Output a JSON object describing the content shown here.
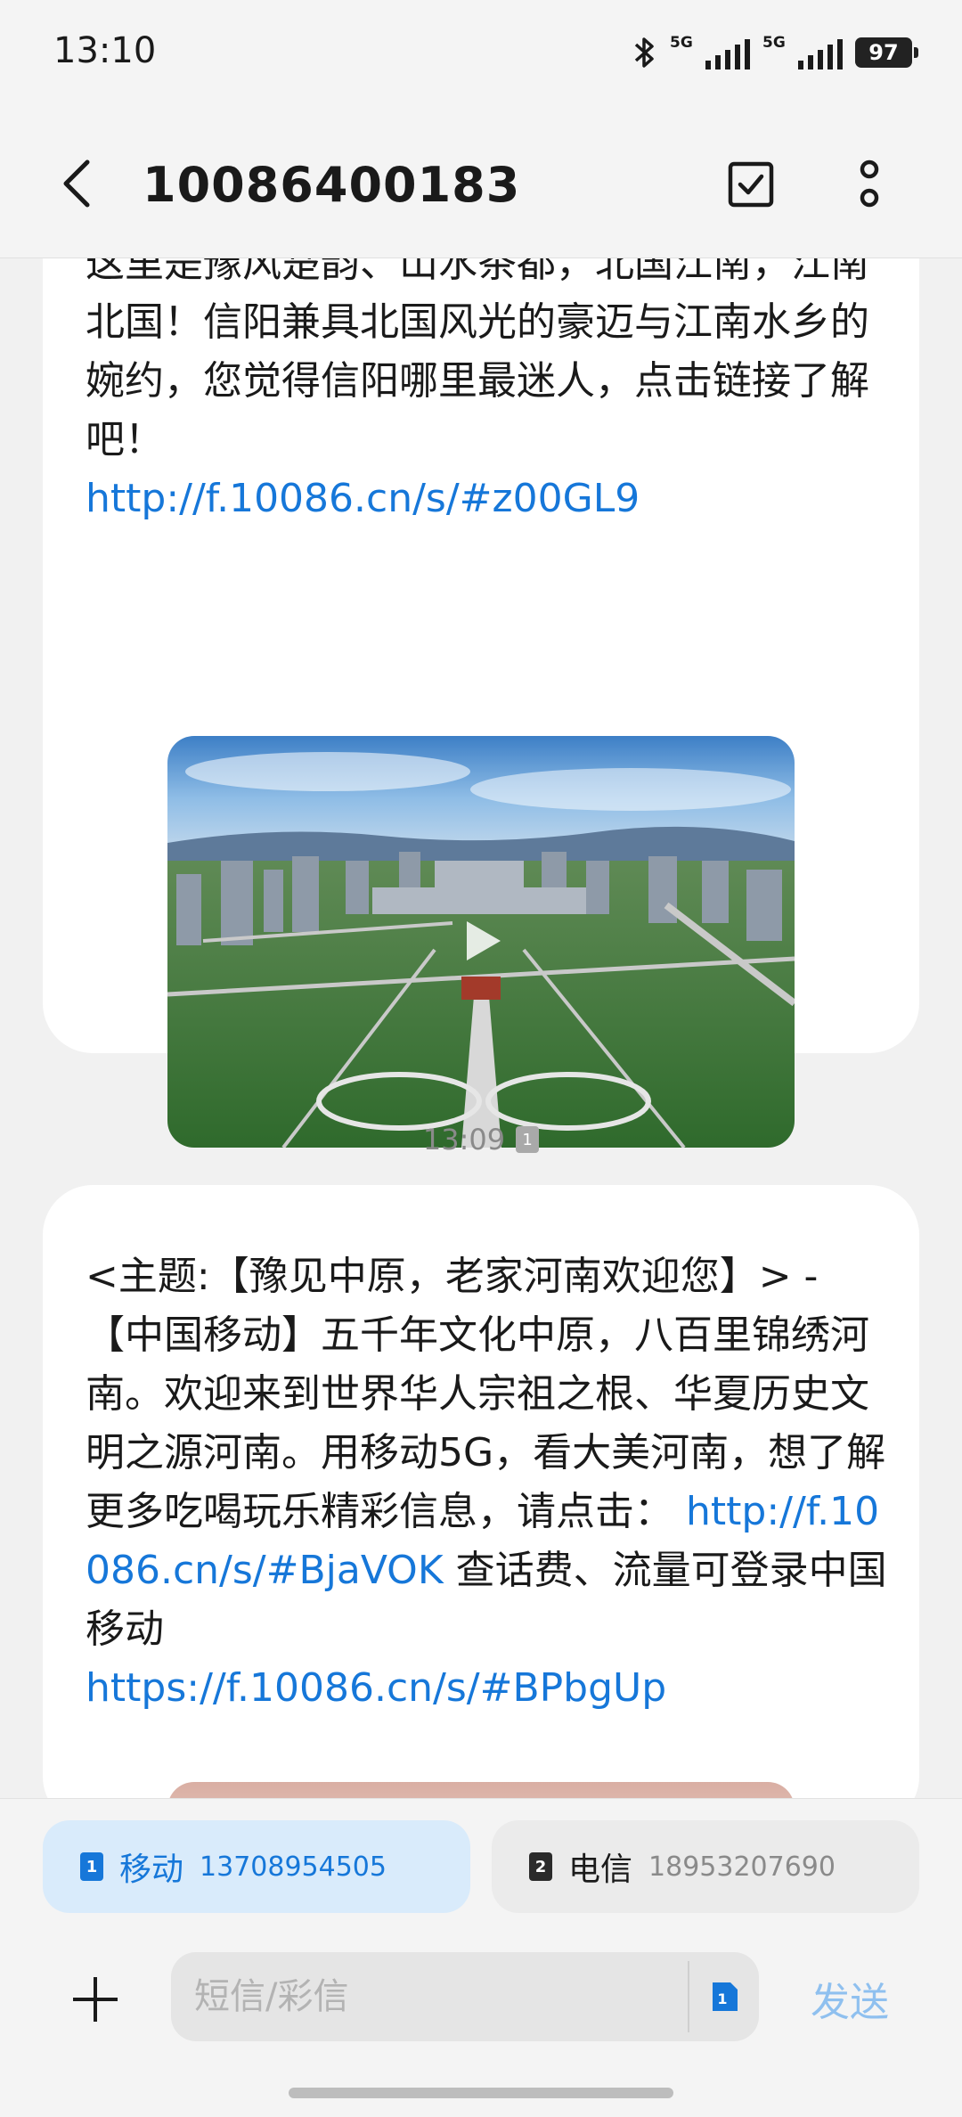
{
  "status_bar": {
    "time": "13:10",
    "network_1": "5G",
    "network_2": "5G",
    "battery": "97"
  },
  "header": {
    "title": "10086400183"
  },
  "messages": [
    {
      "text": "这里是豫风楚韵、山水茶都，北国江南，江南北国！信阳兼具北国风光的豪迈与江南水乡的婉约，您觉得信阳哪里最迷人，点击链接了解吧！",
      "link": "http://f.10086.cn/s/#z00GL9"
    },
    {
      "time": "13:09",
      "sim_badge": "1",
      "text_1": "<主题:【豫见中原，老家河南欢迎您】> -【中国移动】五千年文化中原，八百里锦绣河南。欢迎来到世界华人宗祖之根、华夏历史文明之源河南。用移动5G，看大美河南，想了解更多吃喝玩乐精彩信息，请点击：",
      "link_1": "http://f.10086.cn/s/#BjaVOK",
      "text_2": "查话费、流量可登录中国移动",
      "link_2": "https://f.10086.cn/s/#BPbgUp"
    }
  ],
  "sim_cards": [
    {
      "slot": "1",
      "name": "移动",
      "number": "13708954505",
      "selected": true
    },
    {
      "slot": "2",
      "name": "电信",
      "number": "18953207690",
      "selected": false
    }
  ],
  "compose": {
    "placeholder": "短信/彩信",
    "sim_slot": "1",
    "send_label": "发送"
  },
  "colors": {
    "link": "#1677d9",
    "send_disabled": "#8fc0ef",
    "selected_sim_bg": "#d9ebfb"
  }
}
